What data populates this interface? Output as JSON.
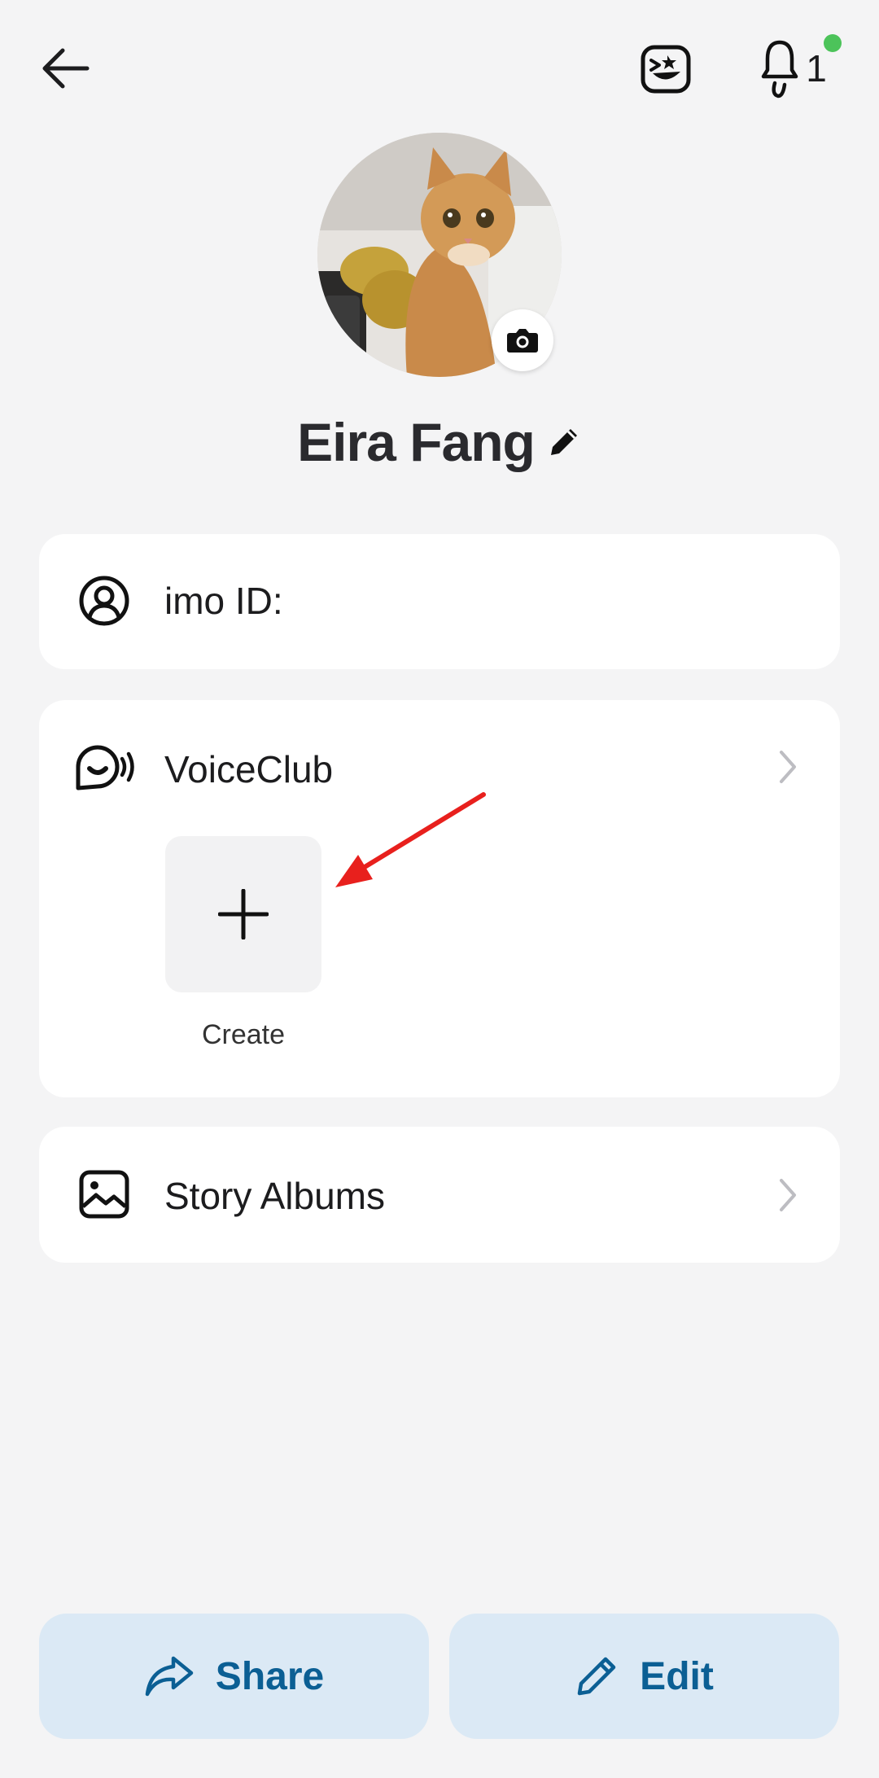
{
  "header": {
    "back_icon": "arrow-left-icon",
    "emoji_icon": "laughing-face-icon",
    "bell_icon": "bell-icon",
    "notification_count": "1",
    "notification_dot_color": "#4cc35a"
  },
  "profile": {
    "avatar_alt": "cat avatar",
    "camera_icon": "camera-icon",
    "name": "Eira Fang",
    "edit_name_icon": "pencil-icon"
  },
  "imo_id": {
    "label": "imo ID:",
    "icon": "user-circle-icon"
  },
  "voice_club": {
    "label": "VoiceClub",
    "icon": "voice-chat-icon",
    "create_label": "Create",
    "annotation_color": "#e8201d"
  },
  "story_albums": {
    "label": "Story Albums",
    "icon": "image-icon"
  },
  "actions": {
    "share_label": "Share",
    "edit_label": "Edit"
  }
}
